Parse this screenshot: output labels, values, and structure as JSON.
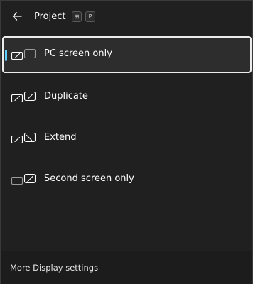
{
  "header": {
    "title": "Project",
    "shortcut_keys": [
      "⊞",
      "P"
    ]
  },
  "options": [
    {
      "label": "PC screen only",
      "icon": "pc-screen-only-icon",
      "selected": true
    },
    {
      "label": "Duplicate",
      "icon": "duplicate-icon",
      "selected": false
    },
    {
      "label": "Extend",
      "icon": "extend-icon",
      "selected": false
    },
    {
      "label": "Second screen only",
      "icon": "second-screen-only-icon",
      "selected": false
    }
  ],
  "footer": {
    "link_label": "More Display settings"
  },
  "colors": {
    "background": "#202020",
    "selection_border": "#ececec",
    "accent": "#60cdff"
  }
}
